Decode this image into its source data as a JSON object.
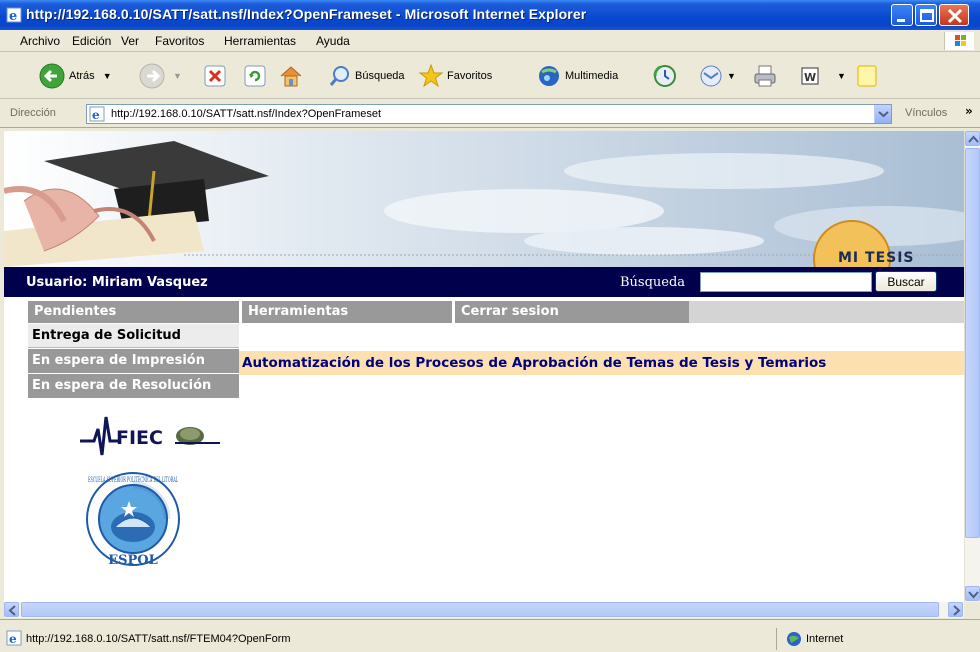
{
  "window": {
    "title": "http://192.168.0.10/SATT/satt.nsf/Index?OpenFrameset - Microsoft Internet Explorer"
  },
  "menu": [
    "Archivo",
    "Edición",
    "Ver",
    "Favoritos",
    "Herramientas",
    "Ayuda"
  ],
  "toolbar": {
    "back": "Atrás",
    "search": "Búsqueda",
    "favorites": "Favoritos",
    "media": "Multimedia"
  },
  "address": {
    "label": "Dirección",
    "url": "http://192.168.0.10/SATT/satt.nsf/Index?OpenFrameset",
    "links": "Vínculos"
  },
  "page": {
    "banner_text": "MI TESIS",
    "user_label": "Usuario: Miriam Vasquez",
    "search_label": "Búsqueda",
    "search_button": "Buscar",
    "search_value": "",
    "nav": [
      "Pendientes",
      "Herramientas",
      "Cerrar sesion"
    ],
    "submenu": [
      "Entrega de Solicitud",
      "En espera de Impresión",
      "En espera de Resolución"
    ],
    "headline": "Automatización de los Procesos de Aprobación de Temas de Tesis y Temarios",
    "fiec_logo": "FIEC",
    "espol_seal": "ESPOL",
    "espol_seal_text": "ESCUELA SUPERIOR POLITECNICA DEL LITORAL"
  },
  "status": {
    "text": "http://192.168.0.10/SATT/satt.nsf/FTEM04?OpenForm",
    "zone": "Internet"
  }
}
